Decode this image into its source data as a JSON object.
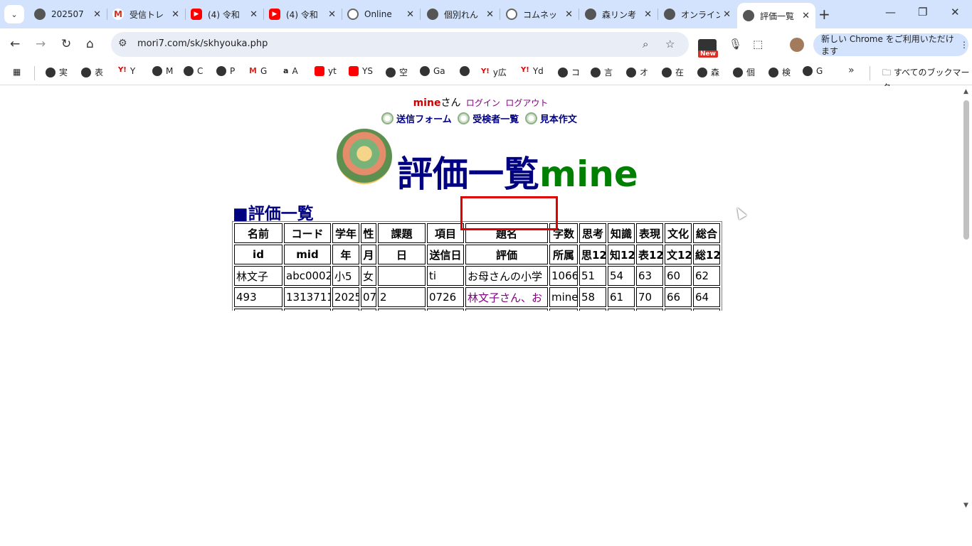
{
  "browser": {
    "tabs": [
      {
        "title": "202507",
        "icon": "globe"
      },
      {
        "title": "受信トレ",
        "icon": "gmail"
      },
      {
        "title": "(4) 令和",
        "icon": "youtube"
      },
      {
        "title": "(4) 令和",
        "icon": "youtube"
      },
      {
        "title": "Online",
        "icon": "gear"
      },
      {
        "title": "個別れん",
        "icon": "globe"
      },
      {
        "title": "コムネッ",
        "icon": "gear"
      },
      {
        "title": "森リン考",
        "icon": "globe"
      },
      {
        "title": "オンライン",
        "icon": "globe"
      },
      {
        "title": "評価一覧",
        "icon": "globe",
        "active": true
      }
    ],
    "url": "mori7.com/sk/skhyouka.php",
    "promo": "新しい Chrome をご利用いただけます",
    "new_badge": "New",
    "bookmarks": [
      {
        "label": "実",
        "icon": "globe"
      },
      {
        "label": "表",
        "icon": "globe"
      },
      {
        "label": "Y",
        "icon": "yahoo"
      },
      {
        "label": "M",
        "icon": "globe"
      },
      {
        "label": "C",
        "icon": "globe"
      },
      {
        "label": "P",
        "icon": "globe"
      },
      {
        "label": "G",
        "icon": "gmail"
      },
      {
        "label": "A",
        "icon": "amazon"
      },
      {
        "label": "yt",
        "icon": "youtube"
      },
      {
        "label": "YS",
        "icon": "youtube"
      },
      {
        "label": "空",
        "icon": "globe"
      },
      {
        "label": "Ga",
        "icon": "globe"
      },
      {
        "label": "",
        "icon": "globe"
      },
      {
        "label": "y広",
        "icon": "yahoo"
      },
      {
        "label": "Yd",
        "icon": "yahoo"
      },
      {
        "label": "コ",
        "icon": "globe"
      },
      {
        "label": "言",
        "icon": "globe"
      },
      {
        "label": "オ",
        "icon": "globe"
      },
      {
        "label": "在",
        "icon": "globe"
      },
      {
        "label": "森",
        "icon": "globe"
      },
      {
        "label": "個",
        "icon": "globe"
      },
      {
        "label": "検",
        "icon": "globe"
      },
      {
        "label": "G",
        "icon": "globe"
      }
    ],
    "all_bookmarks": "すべてのブックマーク"
  },
  "page": {
    "user": {
      "name": "mine",
      "suffix": "さん",
      "login": "ログイン",
      "logout": "ログアウト"
    },
    "nav": [
      "送信フォーム",
      "受検者一覧",
      "見本作文"
    ],
    "title": "評価一覧",
    "title_name": "mine",
    "section": "■評価一覧",
    "table": {
      "header1": [
        "名前",
        "コード",
        "学年",
        "性",
        "課題",
        "項目",
        "題名",
        "字数",
        "思考",
        "知識",
        "表現",
        "文化",
        "総合"
      ],
      "header2": [
        "id",
        "mid",
        "年",
        "月",
        "日",
        "送信日",
        "評価",
        "所属",
        "思12",
        "知12",
        "表12",
        "文12",
        "総12"
      ],
      "row1": [
        "林文子",
        "abc0002",
        "小5",
        "女",
        "",
        "ti",
        "お母さんの小学",
        "1066",
        "51",
        "54",
        "63",
        "60",
        "62"
      ],
      "row2": [
        "493",
        "1313711",
        "2025",
        "07",
        "2",
        "0726",
        "林文子さん、お",
        "mine",
        "58",
        "61",
        "70",
        "66",
        "64"
      ]
    }
  }
}
